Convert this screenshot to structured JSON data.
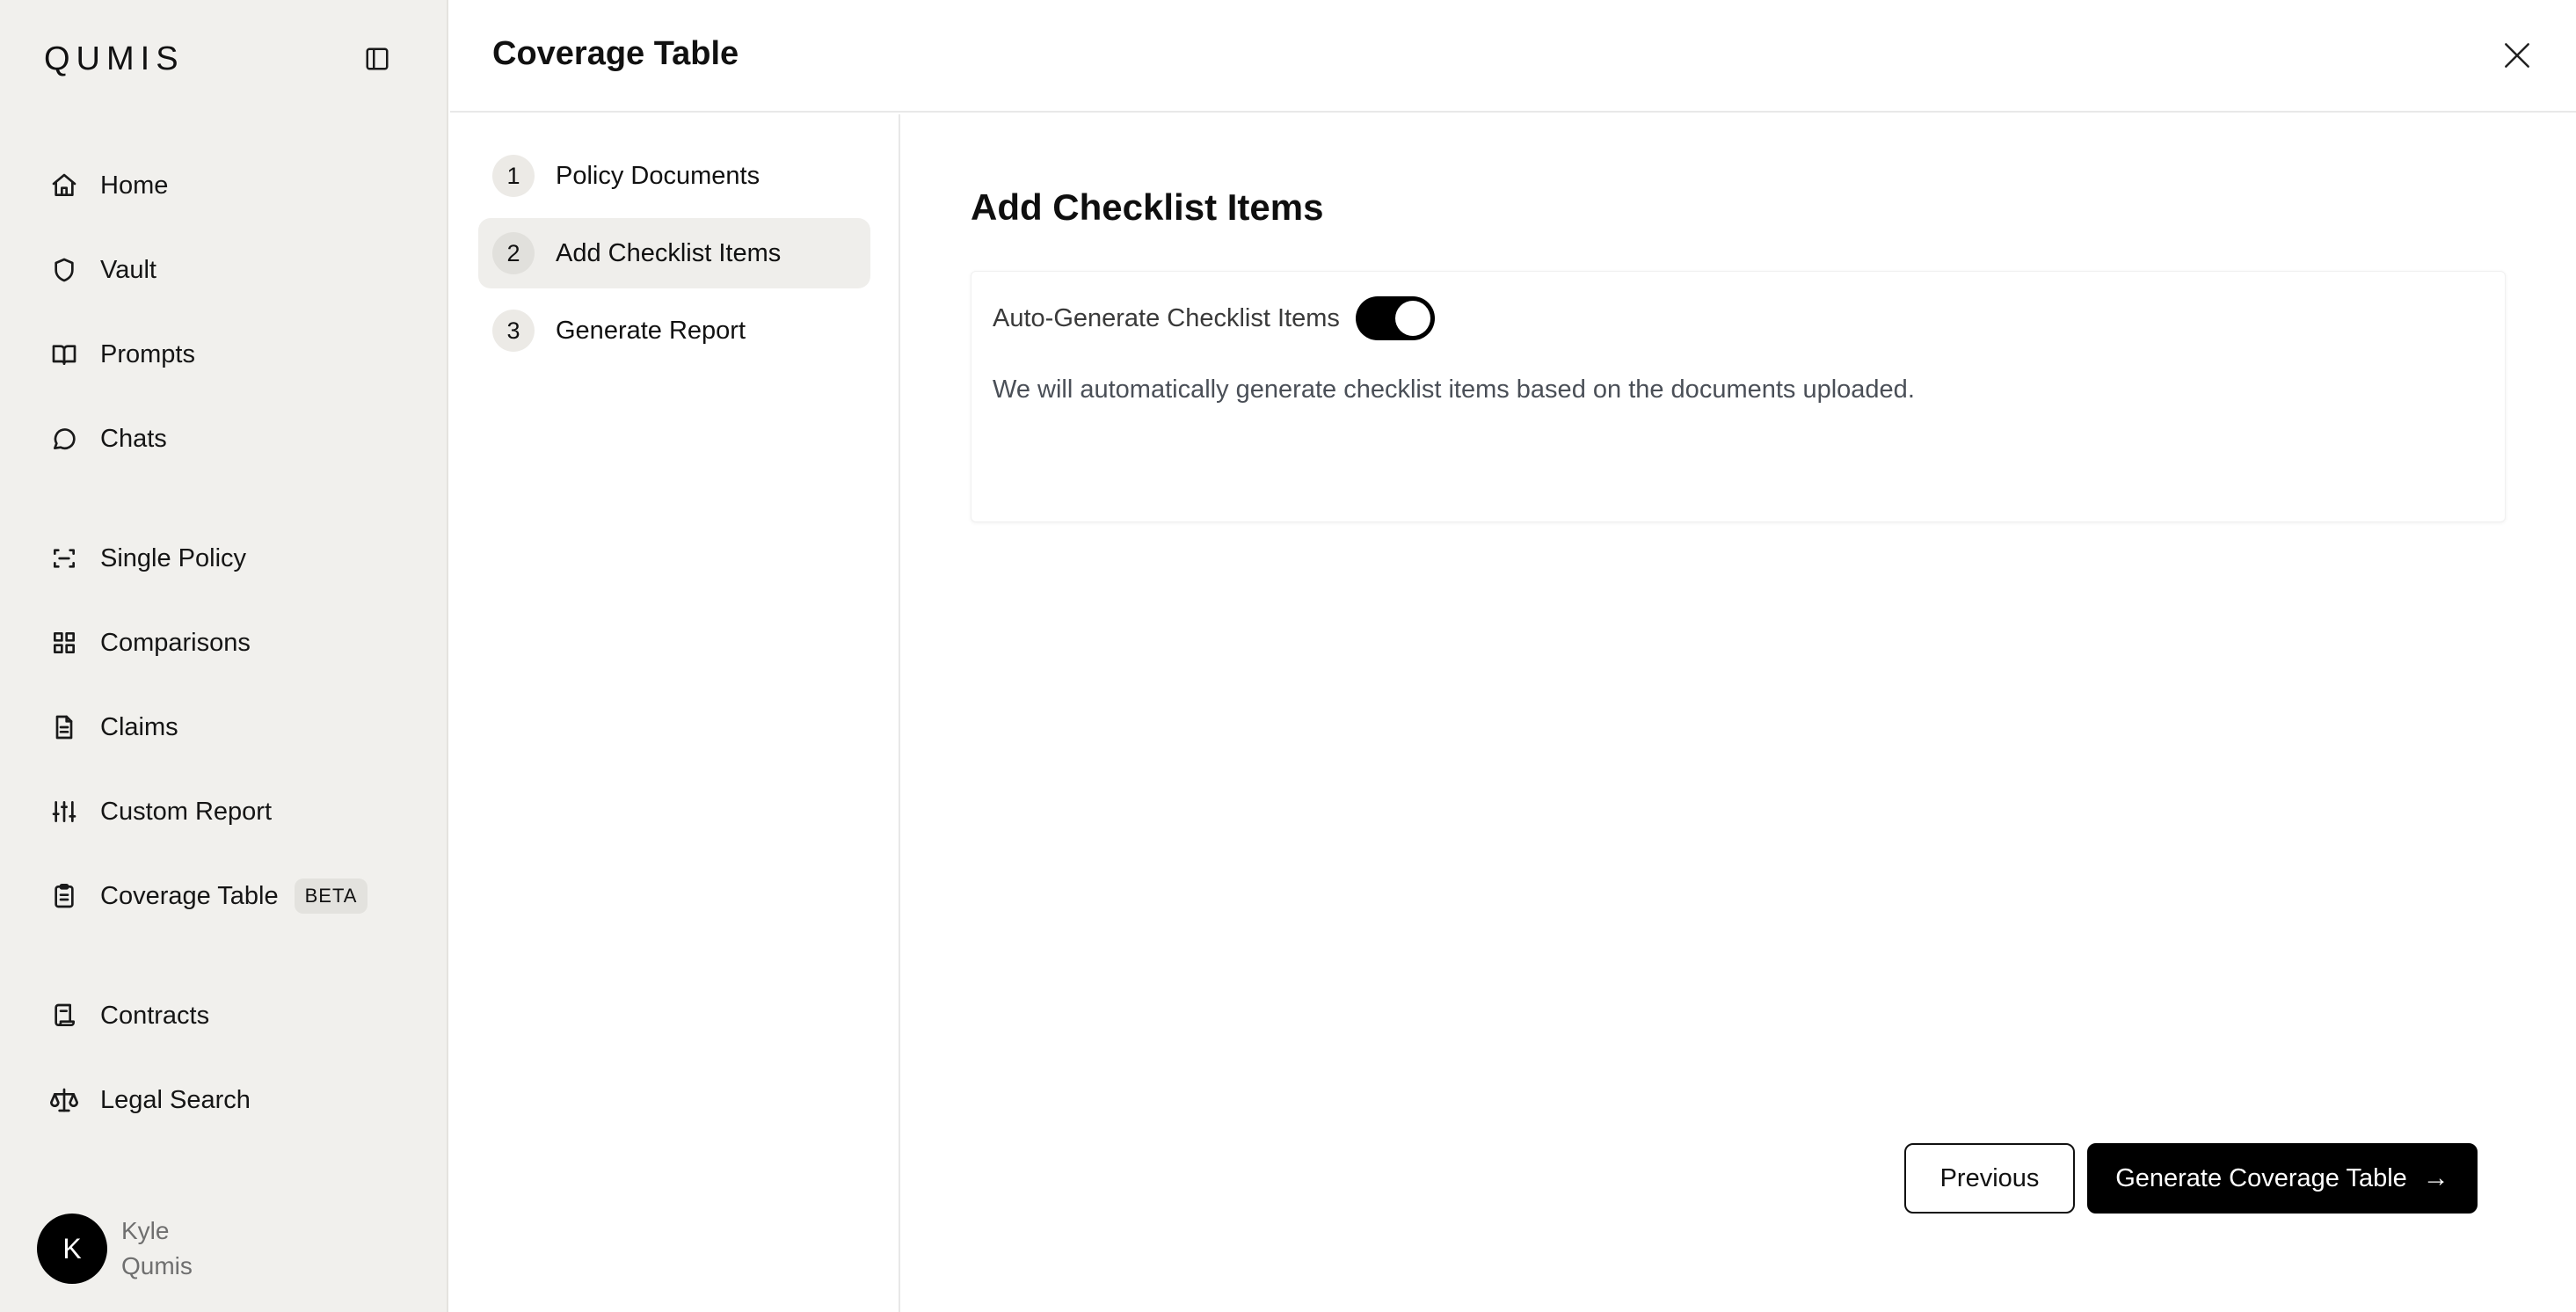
{
  "app": {
    "logo": "QUMIS"
  },
  "sidebar": {
    "items": [
      {
        "label": "Home",
        "icon": "home-icon"
      },
      {
        "label": "Vault",
        "icon": "shield-icon"
      },
      {
        "label": "Prompts",
        "icon": "book-icon"
      },
      {
        "label": "Chats",
        "icon": "chat-bubble-icon"
      },
      {
        "label": "Single Policy",
        "icon": "scan-icon"
      },
      {
        "label": "Comparisons",
        "icon": "grid-icon"
      },
      {
        "label": "Claims",
        "icon": "document-icon"
      },
      {
        "label": "Custom Report",
        "icon": "sliders-icon"
      },
      {
        "label": "Coverage Table",
        "icon": "clipboard-icon",
        "badge": "BETA"
      },
      {
        "label": "Contracts",
        "icon": "scroll-icon"
      },
      {
        "label": "Legal Search",
        "icon": "scale-icon"
      }
    ],
    "user": {
      "initial": "K",
      "first_name": "Kyle",
      "last_name": "Qumis"
    }
  },
  "header": {
    "title": "Coverage Table"
  },
  "steps": [
    {
      "number": "1",
      "label": "Policy Documents",
      "active": false
    },
    {
      "number": "2",
      "label": "Add Checklist Items",
      "active": true
    },
    {
      "number": "3",
      "label": "Generate Report",
      "active": false
    }
  ],
  "main": {
    "section_title": "Add Checklist Items",
    "toggle_label": "Auto-Generate Checklist Items",
    "toggle_on": true,
    "description": "We will automatically generate checklist items based on the documents uploaded.",
    "previous_label": "Previous",
    "generate_label": "Generate Coverage Table",
    "generate_arrow": "→"
  }
}
